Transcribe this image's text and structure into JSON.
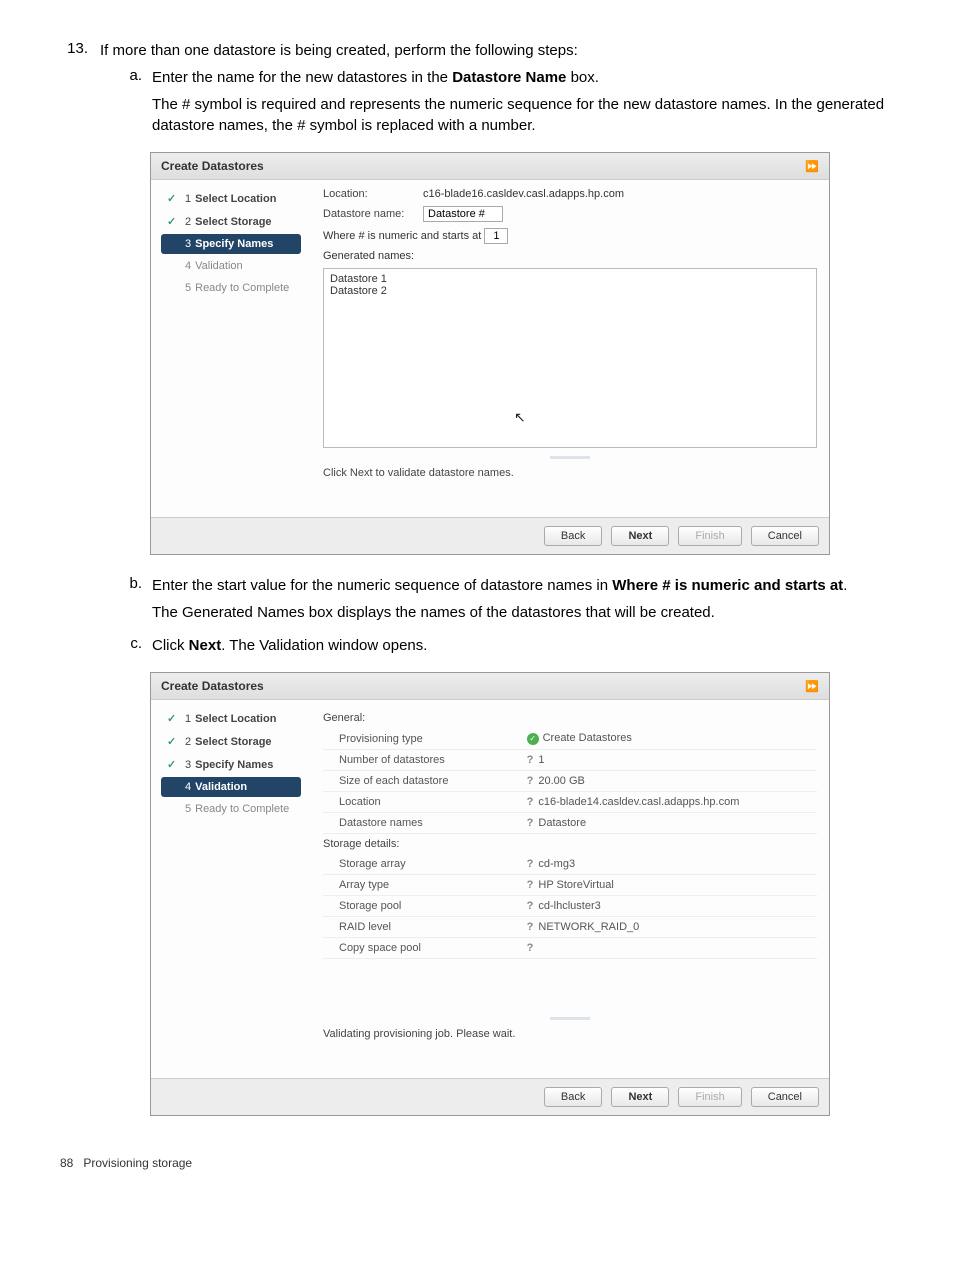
{
  "mainStep": {
    "num": "13.",
    "text_a": "If more than one datastore is being created, perform the following steps:"
  },
  "subA": {
    "letter": "a.",
    "line1_a": "Enter the name for the new datastores in the ",
    "line1_b": "Datastore Name",
    "line1_c": " box.",
    "line2": "The # symbol is required and represents the numeric sequence for the new datastore names. In the generated datastore names, the # symbol is replaced with a number."
  },
  "subB": {
    "letter": "b.",
    "line1_a": "Enter the start value for the numeric sequence of datastore names in ",
    "line1_b": "Where # is numeric and starts at",
    "line1_c": ".",
    "line2": "The Generated Names box displays the names of the datastores that will be created."
  },
  "subC": {
    "letter": "c.",
    "line1_a": "Click ",
    "line1_b": "Next",
    "line1_c": ". The Validation window opens."
  },
  "wiz": {
    "title": "Create Datastores",
    "steps": {
      "s1": "Select Location",
      "s2": "Select Storage",
      "s3": "Specify Names",
      "s4": "Validation",
      "s5": "Ready to Complete"
    },
    "nums": {
      "n1": "1",
      "n2": "2",
      "n3": "3",
      "n4": "4",
      "n5": "5"
    }
  },
  "scr1": {
    "location_label": "Location:",
    "location_value": "c16-blade16.casldev.casl.adapps.hp.com",
    "dsname_label": "Datastore name:",
    "dsname_value": "Datastore #",
    "where_label_a": "Where # is numeric and starts at",
    "where_value": "1",
    "gen_label": "Generated names:",
    "gen1": "Datastore 1",
    "gen2": "Datastore 2",
    "hint": "Click Next to validate datastore names.",
    "btn_back": "Back",
    "btn_next": "Next",
    "btn_finish": "Finish",
    "btn_cancel": "Cancel"
  },
  "scr2": {
    "cat_general": "General:",
    "r1l": "Provisioning type",
    "r1v": "Create Datastores",
    "r2l": "Number of datastores",
    "r2v": "1",
    "r3l": "Size of each datastore",
    "r3v": "20.00 GB",
    "r4l": "Location",
    "r4v": "c16-blade14.casldev.casl.adapps.hp.com",
    "r5l": "Datastore names",
    "r5v": "Datastore",
    "cat_storage": "Storage details:",
    "r6l": "Storage array",
    "r6v": "cd-mg3",
    "r7l": "Array type",
    "r7v": "HP StoreVirtual",
    "r8l": "Storage pool",
    "r8v": "cd-lhcluster3",
    "r9l": "RAID level",
    "r9v": "NETWORK_RAID_0",
    "r10l": "Copy space pool",
    "r10v": "",
    "hint": "Validating provisioning job. Please wait.",
    "btn_back": "Back",
    "btn_next": "Next",
    "btn_finish": "Finish",
    "btn_cancel": "Cancel"
  },
  "footer": {
    "pagenum": "88",
    "section": "Provisioning storage"
  },
  "icons": {
    "check": "✓",
    "dbl": "⏩",
    "q": "?"
  }
}
